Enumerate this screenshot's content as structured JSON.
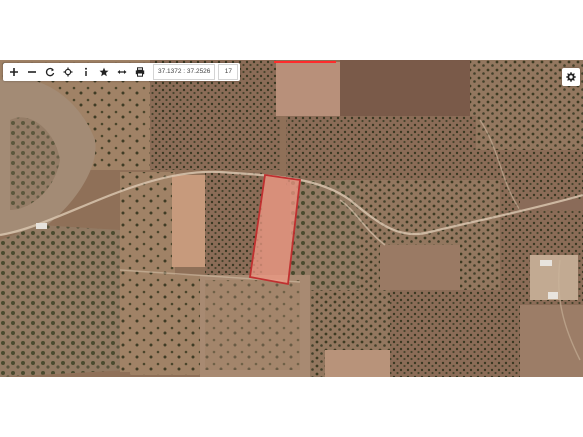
{
  "toolbar": {
    "buttons": [
      {
        "id": "zoom-in",
        "icon": "plus-icon"
      },
      {
        "id": "zoom-out",
        "icon": "minus-icon"
      },
      {
        "id": "refresh",
        "icon": "refresh-icon"
      },
      {
        "id": "locate",
        "icon": "crosshair-icon"
      },
      {
        "id": "info",
        "icon": "info-icon"
      },
      {
        "id": "favorite",
        "icon": "star-icon"
      },
      {
        "id": "measure",
        "icon": "double-arrow-icon"
      },
      {
        "id": "print",
        "icon": "printer-icon"
      }
    ],
    "coordinates": "37.1372 : 37.2526",
    "zoom_level": "17"
  },
  "settings": {
    "icon": "gear-icon"
  },
  "map": {
    "type": "satellite",
    "parcel_highlight_color": "#e0483e",
    "parcel_fill_color": "#f09a86",
    "adjacent_boundary_color": "#ff2b2b"
  }
}
